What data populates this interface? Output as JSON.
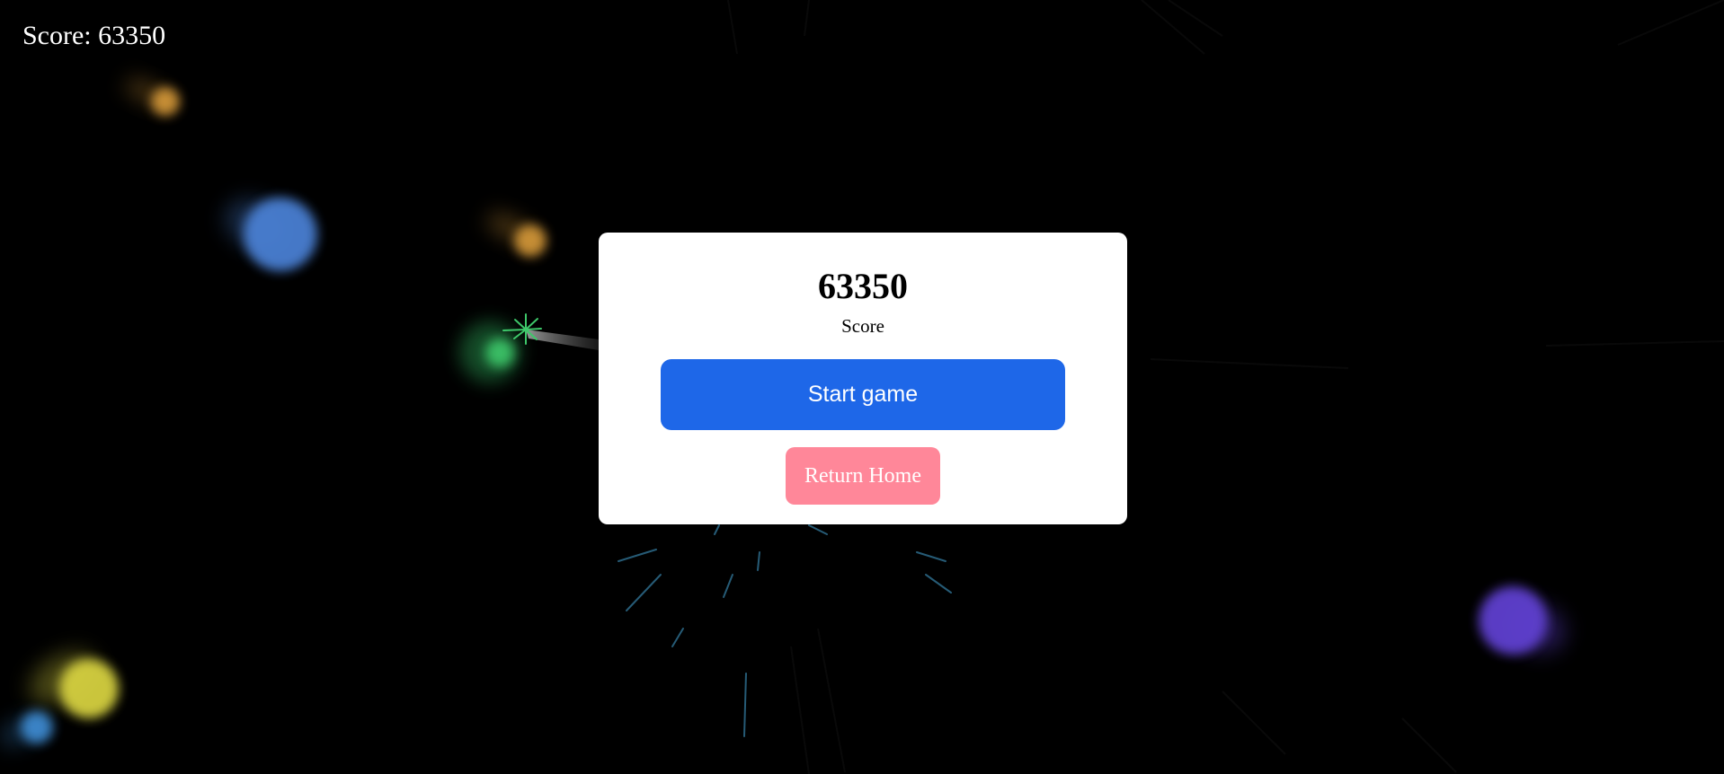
{
  "hud": {
    "score_text": "Score: 63350"
  },
  "modal": {
    "score_value": "63350",
    "score_label": "Score",
    "start_button_label": "Start game",
    "return_button_label": "Return Home"
  },
  "colors": {
    "background": "#000000",
    "modal_background": "#ffffff",
    "start_button": "#1e67e8",
    "return_button": "#ff8799",
    "orb_orange": "#e5a43d",
    "orb_blue": "#4a7fd2",
    "orb_green": "#3ec86a",
    "orb_yellow": "#d5d040",
    "orb_purple": "#5e3fcf",
    "orb_small_blue": "#3f8fd8",
    "particle_cyan": "#46a7d8"
  },
  "icons": {
    "player": "green-spiky-orb-icon",
    "particles": "cyan-burst-icon"
  }
}
